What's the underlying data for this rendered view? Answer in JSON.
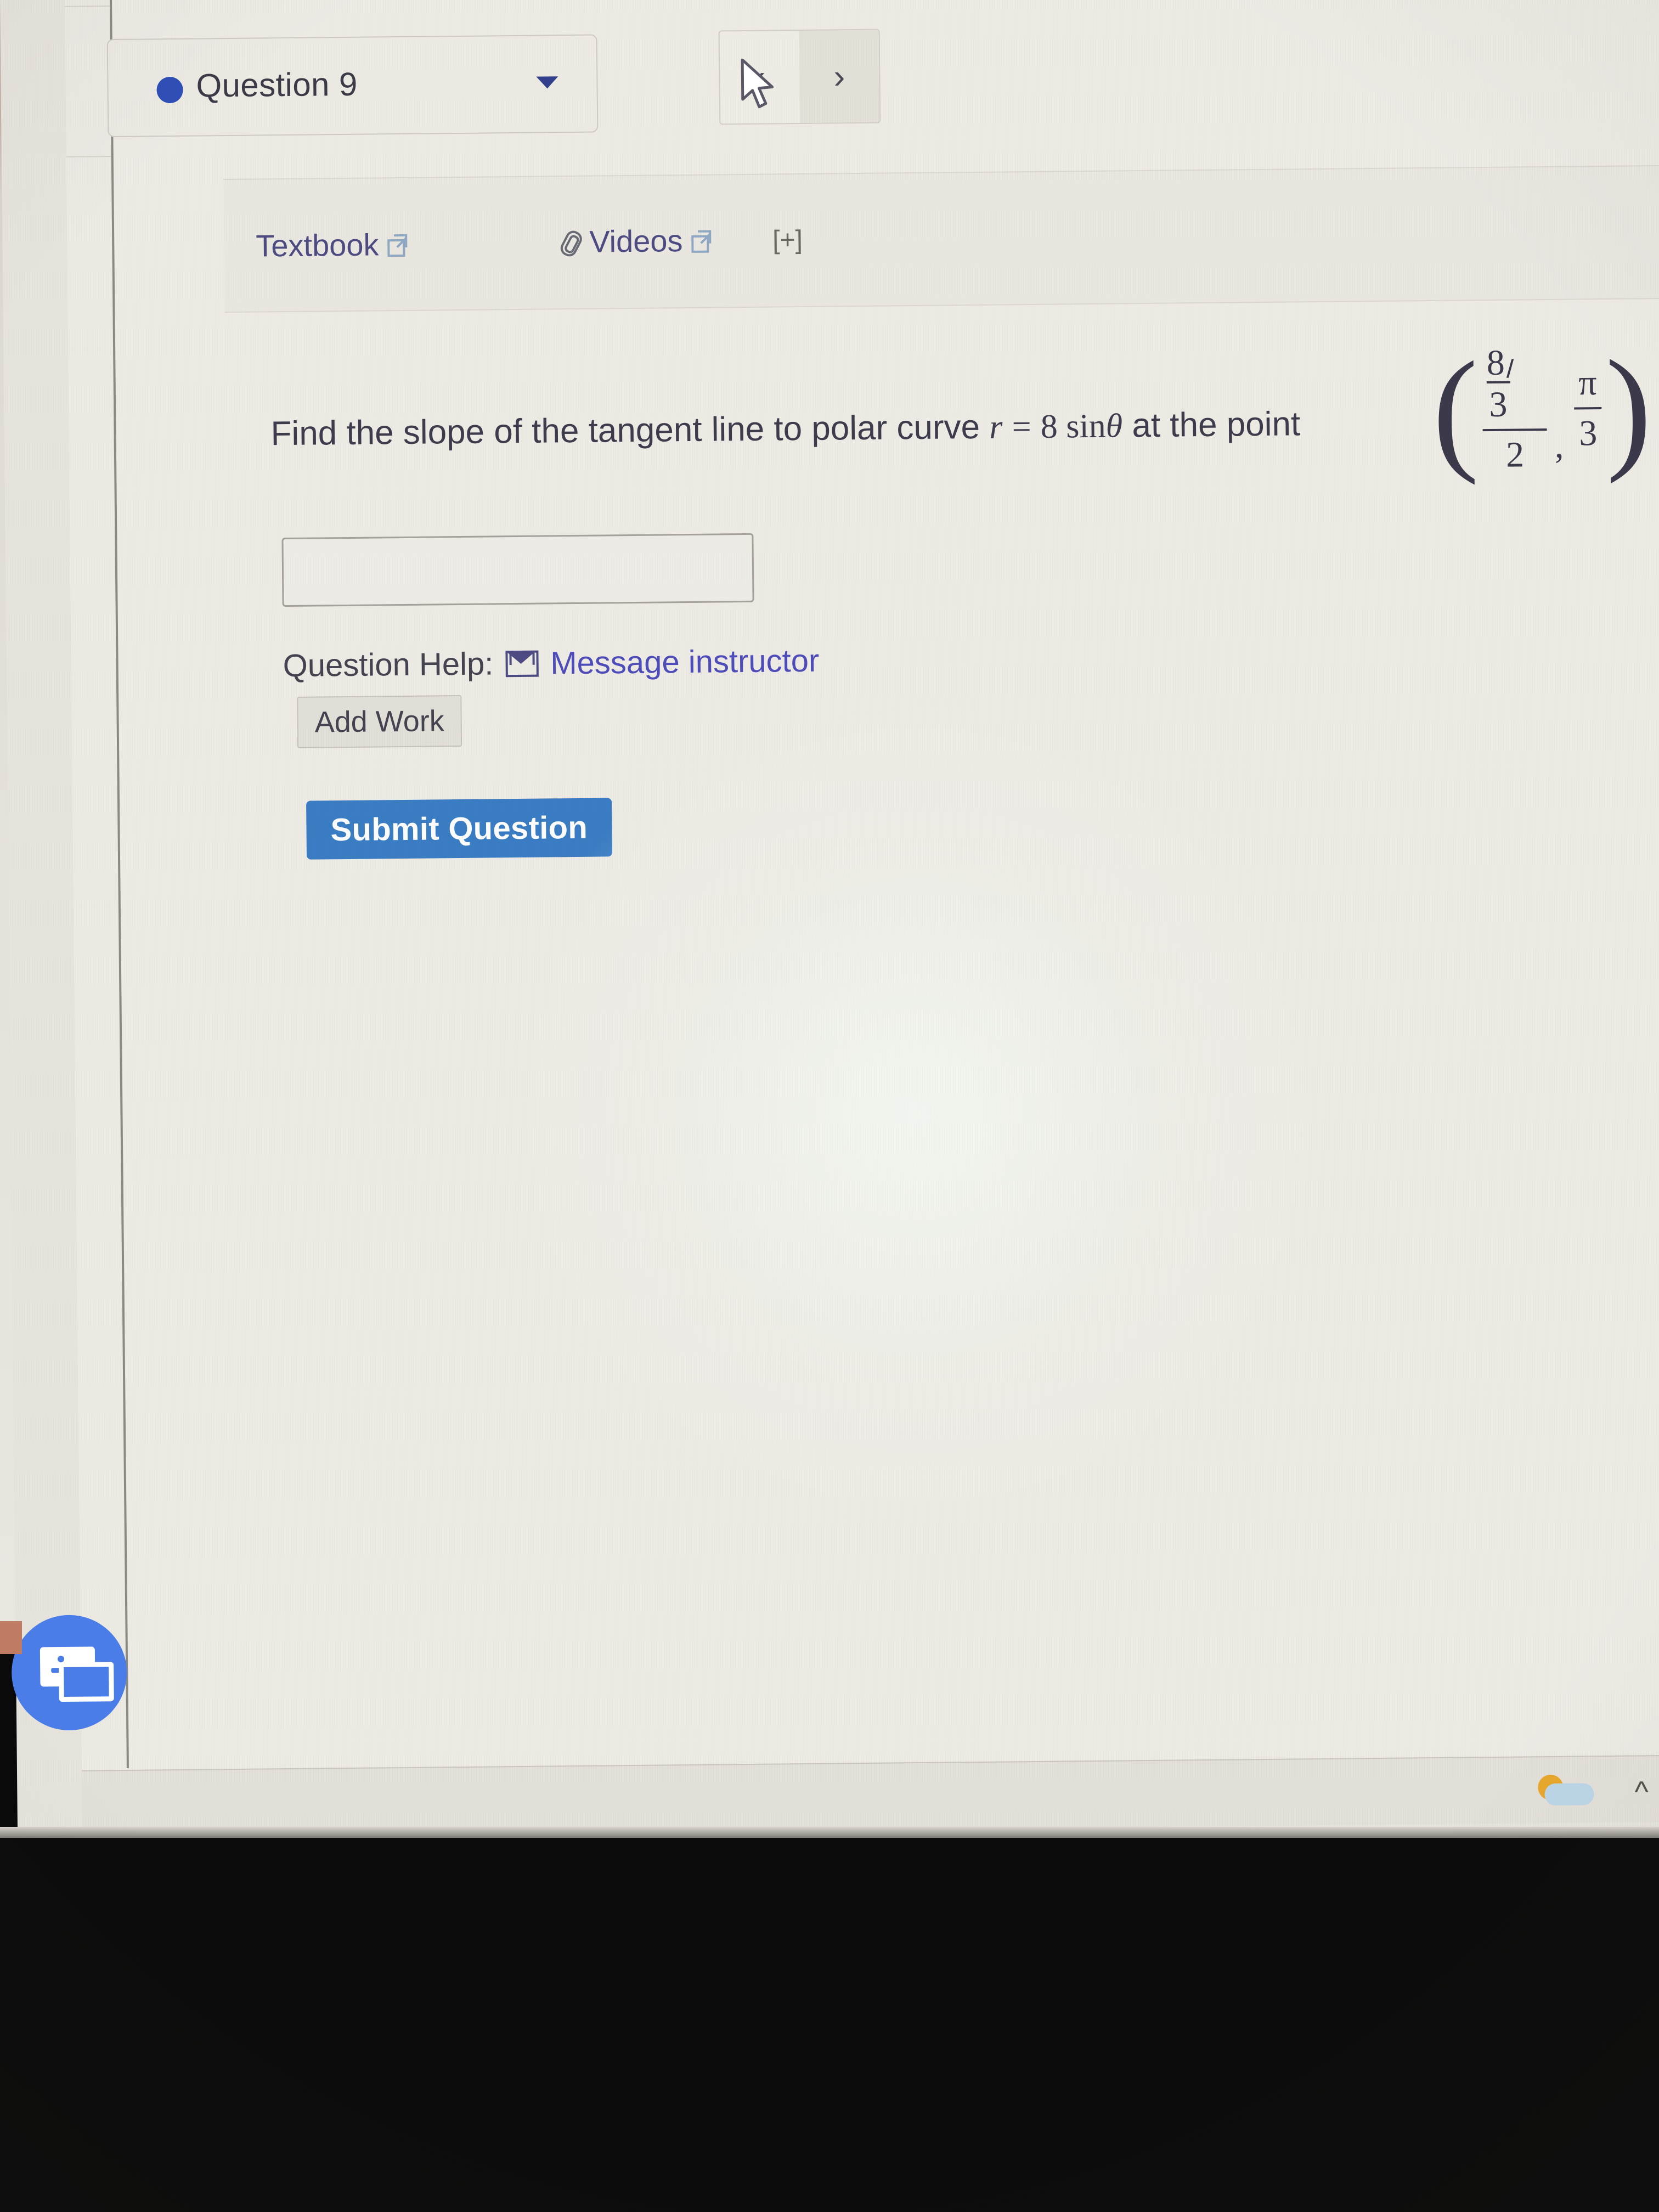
{
  "question_nav": {
    "status_marker": "filled-circle",
    "label": "Question 9",
    "dropdown_caret": "▾",
    "prev_label": "‹",
    "next_label": "›"
  },
  "resources": {
    "textbook": {
      "label": "Textbook",
      "icon": "external-link-icon"
    },
    "videos": {
      "label": "Videos",
      "icon": "paperclip-icon",
      "link_icon": "external-link-icon"
    },
    "expand": "[+]"
  },
  "question": {
    "text_part1": "Find the slope of the tangent line to polar curve",
    "equation_r": "r",
    "equation_eq": "=",
    "equation_rhs": "8 sin",
    "equation_theta": "θ",
    "text_part2": "at the point",
    "point": {
      "x_numerator_coeff": "8",
      "x_numerator_radicand": "3",
      "x_denominator": "2",
      "y_numerator": "π",
      "y_denominator": "3",
      "separator": ",",
      "trailing": "."
    }
  },
  "answer_input": {
    "value": "",
    "placeholder": ""
  },
  "help": {
    "label": "Question Help:",
    "message_icon": "envelope-icon",
    "message_link": "Message instructor"
  },
  "buttons": {
    "add_work": "Add Work",
    "submit": "Submit Question"
  },
  "chat_fab": {
    "icon": "chat-bubble-icon"
  },
  "taskbar": {
    "weather_icon": "weather-sun-cloud-icon",
    "show_hidden_icon": "chevron-up-icon",
    "onedrive_icon": "onedrive-cloud-icon"
  },
  "colors": {
    "accent_blue": "#3b7dc4",
    "link_blue": "#4e4cba",
    "marker_blue": "#2f4fb8",
    "fab_blue": "#4a7de8",
    "screen_bg": "#e7e4dd"
  }
}
